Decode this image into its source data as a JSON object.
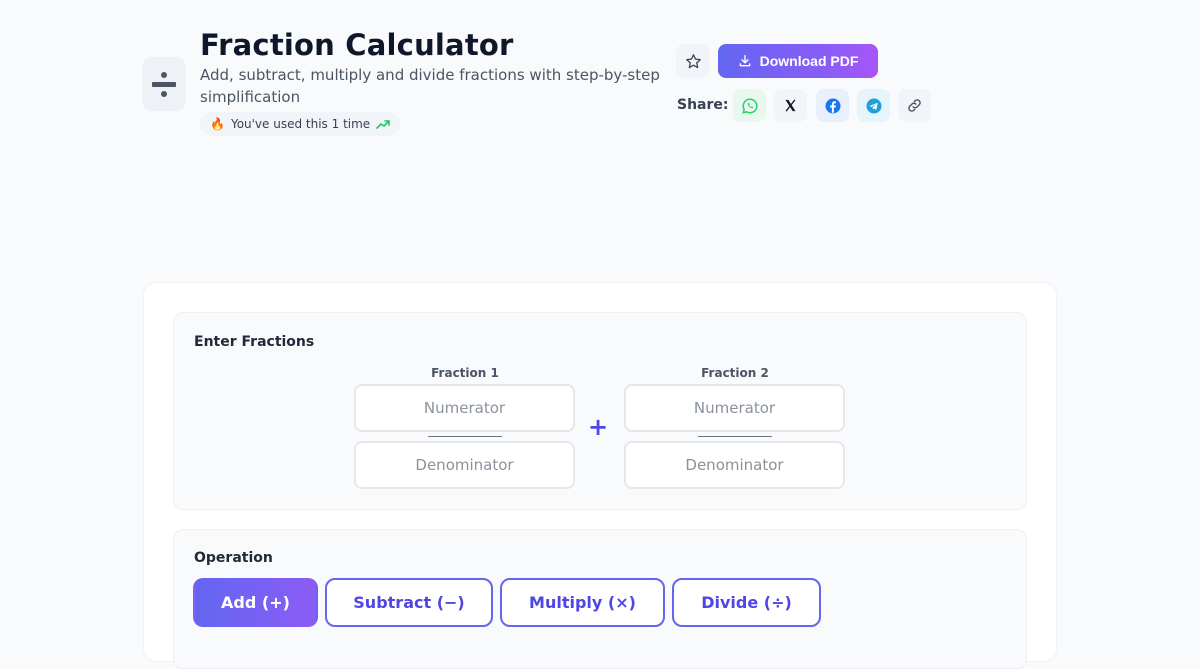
{
  "header": {
    "title": "Fraction Calculator",
    "subtitle": "Add, subtract, multiply and divide fractions with step-by-step simplification",
    "usage_text": "You've used this 1 time",
    "usage_icon": "fire-icon",
    "trend_icon": "trending-up-icon",
    "app_icon": "divide-icon"
  },
  "actions": {
    "favorite_icon": "star-icon",
    "download_label": "Download PDF",
    "download_icon": "download-icon",
    "share_label": "Share:",
    "share_buttons": [
      {
        "name": "whatsapp",
        "color": "#25d366",
        "bg": "#e9f8ef"
      },
      {
        "name": "x",
        "color": "#111827",
        "bg": "#f1f5f9"
      },
      {
        "name": "facebook",
        "color": "#1877f2",
        "bg": "#e8f0fd"
      },
      {
        "name": "telegram",
        "color": "#229ed9",
        "bg": "#e6f4fb"
      },
      {
        "name": "copy-link",
        "color": "#4b5563",
        "bg": "#f1f5f9"
      }
    ]
  },
  "fractions": {
    "section_title": "Enter Fractions",
    "fraction1": {
      "label": "Fraction 1",
      "numerator_placeholder": "Numerator",
      "numerator_value": "",
      "denominator_placeholder": "Denominator",
      "denominator_value": ""
    },
    "operator_symbol": "+",
    "fraction2": {
      "label": "Fraction 2",
      "numerator_placeholder": "Numerator",
      "numerator_value": "",
      "denominator_placeholder": "Denominator",
      "denominator_value": ""
    }
  },
  "operation": {
    "section_title": "Operation",
    "selected": "add",
    "buttons": [
      {
        "id": "add",
        "label": "Add (+)"
      },
      {
        "id": "subtract",
        "label": "Subtract (−)"
      },
      {
        "id": "multiply",
        "label": "Multiply (×)"
      },
      {
        "id": "divide",
        "label": "Divide (÷)"
      }
    ]
  },
  "colors": {
    "accent": "#6366f1",
    "accent_end": "#a855f7",
    "background": "#f8fafc"
  }
}
